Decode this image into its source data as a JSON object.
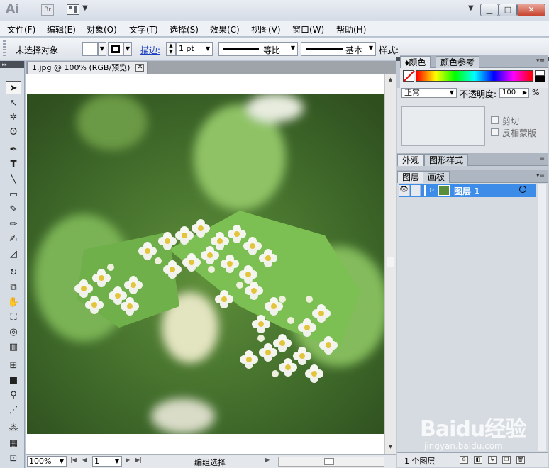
{
  "titlebar": {
    "logo": "Ai",
    "bridge": "Br"
  },
  "menu": [
    "文件(F)",
    "编辑(E)",
    "对象(O)",
    "文字(T)",
    "选择(S)",
    "效果(C)",
    "视图(V)",
    "窗口(W)",
    "帮助(H)"
  ],
  "control": {
    "selection_status": "未选择对象",
    "stroke_label": "描边:",
    "stroke_weight": "1 pt",
    "profile_label": "等比",
    "brush_label": "基本",
    "style_label": "样式:"
  },
  "document": {
    "tab_title": "1.jpg @ 100% (RGB/预览)",
    "zoom": "100%",
    "page": "1",
    "status": "编组选择"
  },
  "panels": {
    "color_tabs": [
      "颜色",
      "颜色参考"
    ],
    "transparency": {
      "mode": "正常",
      "opacity_label": "不透明度:",
      "opacity": "100",
      "percent": "%"
    },
    "clip_label": "剪切",
    "invert_mask_label": "反相蒙版",
    "appearance_tabs": [
      "外观",
      "图形样式"
    ],
    "layers_tabs": [
      "图层",
      "画板"
    ],
    "layer_name": "图层 1",
    "layer_count": "1 个图层"
  },
  "watermark": {
    "logo": "Baidu经验",
    "url": "jingyan.baidu.com"
  },
  "colors": {
    "selection_blue": "#3c8ce8",
    "stroke_link_blue": "#1a3fbf",
    "leaf_green": "#6fb04a"
  }
}
